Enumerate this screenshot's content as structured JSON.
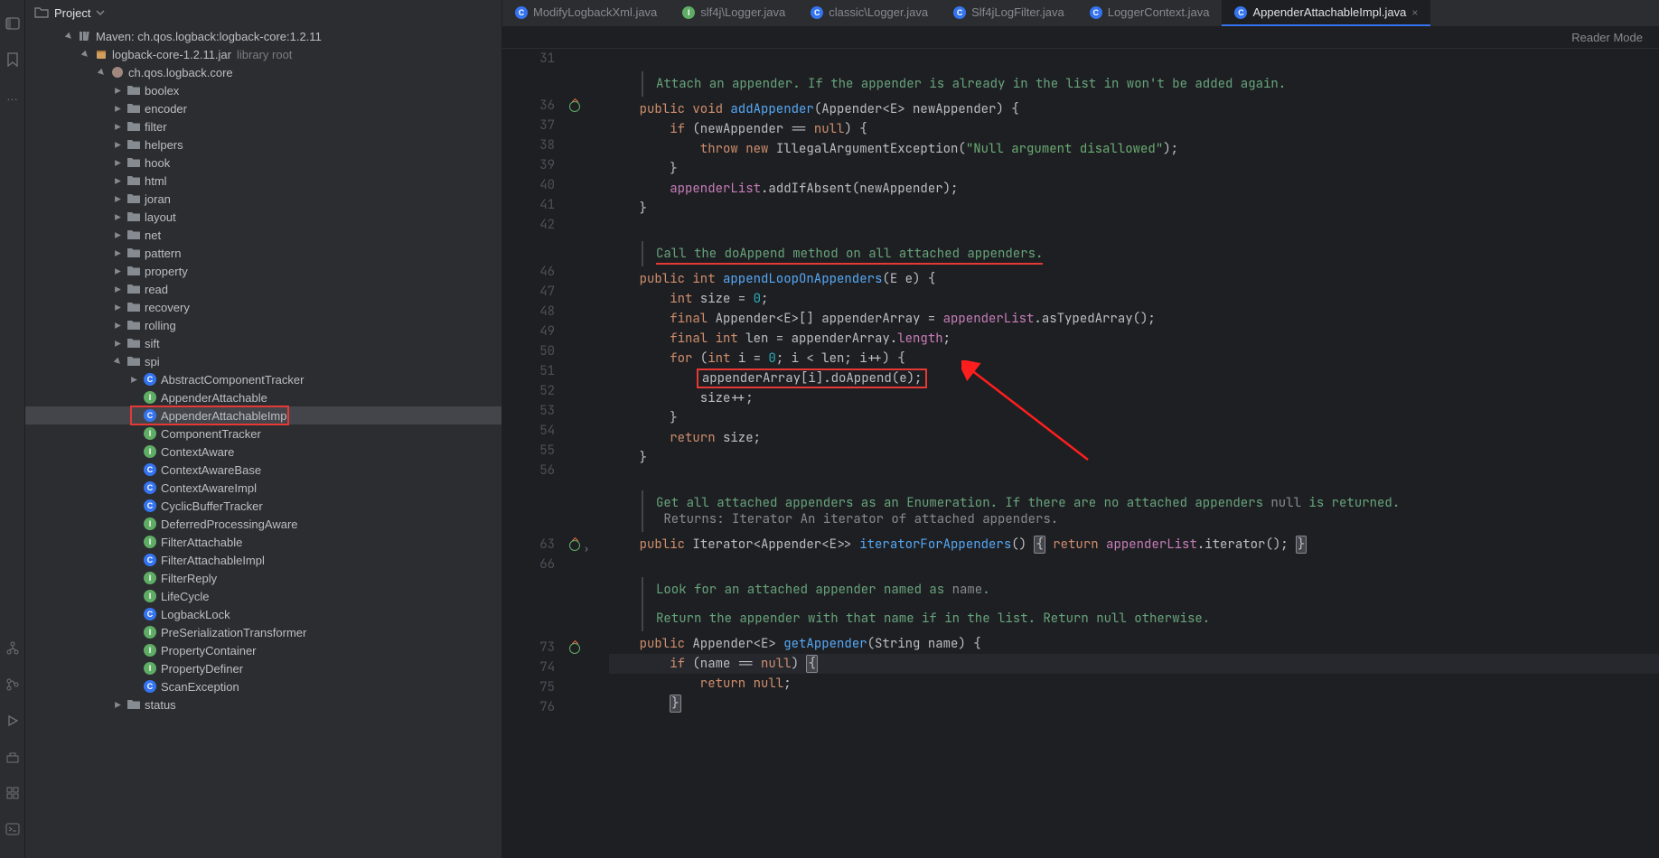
{
  "project": {
    "label": "Project"
  },
  "reader_mode": "Reader Mode",
  "tree": {
    "root_label": "Maven: ch.qos.logback:logback-core:1.2.11",
    "jar_label": "logback-core-1.2.11.jar",
    "jar_suffix": "library root",
    "pkg_label": "ch.qos.logback.core",
    "folders": [
      "boolex",
      "encoder",
      "filter",
      "helpers",
      "hook",
      "html",
      "joran",
      "layout",
      "net",
      "pattern",
      "property",
      "read",
      "recovery",
      "rolling",
      "sift"
    ],
    "spi_label": "spi",
    "spi_items": [
      {
        "icon": "c",
        "name": "AbstractComponentTracker",
        "expand": true
      },
      {
        "icon": "i",
        "name": "AppenderAttachable"
      },
      {
        "icon": "c",
        "name": "AppenderAttachableImpl",
        "selected": true,
        "boxed": true
      },
      {
        "icon": "i",
        "name": "ComponentTracker"
      },
      {
        "icon": "i",
        "name": "ContextAware"
      },
      {
        "icon": "c",
        "name": "ContextAwareBase"
      },
      {
        "icon": "c",
        "name": "ContextAwareImpl"
      },
      {
        "icon": "c",
        "name": "CyclicBufferTracker"
      },
      {
        "icon": "i",
        "name": "DeferredProcessingAware"
      },
      {
        "icon": "i",
        "name": "FilterAttachable"
      },
      {
        "icon": "c",
        "name": "FilterAttachableImpl"
      },
      {
        "icon": "i",
        "name": "FilterReply"
      },
      {
        "icon": "i",
        "name": "LifeCycle"
      },
      {
        "icon": "c",
        "name": "LogbackLock"
      },
      {
        "icon": "i",
        "name": "PreSerializationTransformer"
      },
      {
        "icon": "i",
        "name": "PropertyContainer"
      },
      {
        "icon": "i",
        "name": "PropertyDefiner"
      },
      {
        "icon": "c",
        "name": "ScanException"
      }
    ],
    "status_label": "status"
  },
  "tabs": [
    {
      "icon": "c",
      "label": "ModifyLogbackXml.java"
    },
    {
      "icon": "i",
      "label": "slf4j\\Logger.java"
    },
    {
      "icon": "c",
      "label": "classic\\Logger.java"
    },
    {
      "icon": "c",
      "label": "Slf4jLogFilter.java"
    },
    {
      "icon": "c",
      "label": "LoggerContext.java"
    },
    {
      "icon": "c",
      "label": "AppenderAttachableImpl.java",
      "active": true
    }
  ],
  "doc1": "Attach an appender. If the appender is already in the list in won't be added again.",
  "doc2_a": "Call the ",
  "doc2_b": "doAppend",
  "doc2_c": " method on all attached appenders.",
  "doc3_a": "Get all attached appenders as an Enumeration. If there are no attached appenders ",
  "doc3_b": "null",
  "doc3_c": " is returned.",
  "doc3_ret": " Returns: Iterator An iterator of attached appenders.",
  "doc4_a": "Look for an attached appender named as ",
  "doc4_b": "name",
  "doc4_c": ".",
  "doc4_ret": "Return the appender with that name if in the list. Return null otherwise.",
  "lines": {
    "l31": "31",
    "l36": "36",
    "l37": "37",
    "l38": "38",
    "l39": "39",
    "l40": "40",
    "l41": "41",
    "l42": "42",
    "l46": "46",
    "l47": "47",
    "l48": "48",
    "l49": "49",
    "l50": "50",
    "l51": "51",
    "l52": "52",
    "l53": "53",
    "l54": "54",
    "l55": "55",
    "l56": "56",
    "l63": "63",
    "l66": "66",
    "l73": "73",
    "l74": "74",
    "l75": "75",
    "l76": "76"
  },
  "code": {
    "l36": {
      "a": "    public",
      "b": " void",
      "c": " addAppender",
      "d": "(Appender<",
      "e": "E",
      "f": "> newAppender) {"
    },
    "l37": {
      "a": "        if",
      "b": " (newAppender ",
      "c": "==",
      "d": " null",
      "e": ") {"
    },
    "l38": {
      "a": "            throw",
      "b": " new",
      "c": " IllegalArgumentException(",
      "d": "\"Null argument disallowed\"",
      "e": ");"
    },
    "l39": "        }",
    "l40": {
      "a": "        ",
      "b": "appenderList",
      "c": ".addIfAbsent(newAppender);"
    },
    "l41": "    }",
    "l42": "",
    "l46": {
      "a": "    public",
      "b": " int",
      "c": " appendLoopOnAppenders",
      "d": "(",
      "e": "E",
      "f": " e) {"
    },
    "l47": {
      "a": "        int",
      "b": " size = ",
      "c": "0",
      "d": ";"
    },
    "l48": {
      "a": "        final",
      "b": " Appender<",
      "c": "E",
      "d": ">[] appenderArray = ",
      "e": "appenderList",
      "f": ".asTypedArray();"
    },
    "l49": {
      "a": "        final",
      "b": " int",
      "c": " len = appenderArray.",
      "d": "length",
      "e": ";"
    },
    "l50": {
      "a": "        for",
      "b": " (",
      "c": "int",
      "d": " i = ",
      "e": "0",
      "f": "; i < len; i++) {"
    },
    "l51": {
      "a": "            ",
      "b": "appenderArray[i].doAppend(e);"
    },
    "l52": {
      "a": "            size++",
      ";": ";",
      "b": ";"
    },
    "l53": "        }",
    "l54": {
      "a": "        return",
      "b": " size;"
    },
    "l55": "    }",
    "l56": "",
    "l63": {
      "a": "    public",
      "b": " Iterator<Appender<",
      "c": "E",
      "d": ">> ",
      "e": "iteratorForAppenders",
      "f": "() ",
      "g": "{",
      "h": " return",
      "i": " appenderList",
      "j": ".iterator(); ",
      "k": "}"
    },
    "l66": "",
    "l73": {
      "a": "    public",
      "b": " Appender<",
      "c": "E",
      "d": "> ",
      "e": "getAppender",
      "f": "(String name) {"
    },
    "l74": {
      "a": "        if",
      "b": " (name ",
      "c": "==",
      "d": " null",
      "e": ") ",
      "f": "{"
    },
    "l75": {
      "a": "            return",
      "b": " null",
      "c": ";"
    },
    "l76": {
      "a": "        ",
      "b": "}"
    }
  }
}
